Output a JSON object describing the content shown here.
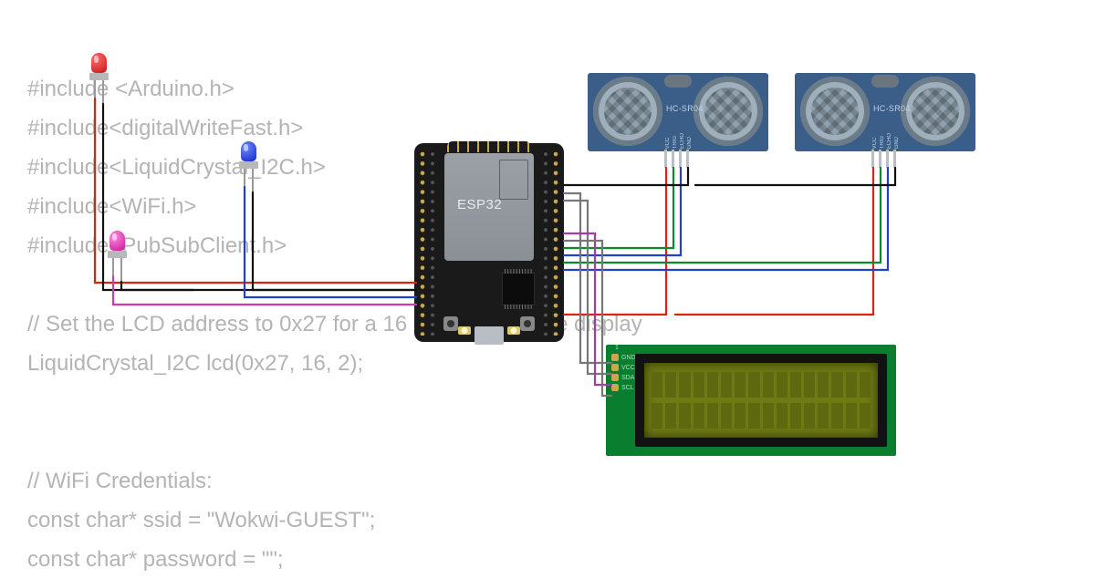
{
  "code_lines": [
    "#include <Arduino.h>",
    "#include<digitalWriteFast.h>",
    "#include<LiquidCrystal_I2C.h>",
    "#include<WiFi.h>",
    "#include<PubSubClient.h>",
    "",
    "// Set the LCD address to 0x27 for a 16 chars and 2 line display",
    "LiquidCrystal_I2C lcd(0x27, 16, 2);",
    "",
    "",
    "// WiFi Credentials:",
    "const char* ssid = \"Wokwi-GUEST\";",
    "const char* password = \"\";"
  ],
  "esp32": {
    "label": "ESP32"
  },
  "sonar": {
    "brand": "HC-SR04",
    "pins": [
      "VCC",
      "TRIG",
      "ECHO",
      "GND"
    ]
  },
  "lcd": {
    "title": "1",
    "pins": [
      "GND",
      "VCC",
      "SDA",
      "SCL"
    ],
    "cols": 16,
    "rows": 2
  },
  "leds": {
    "red": "red-led",
    "blue": "blue-led",
    "pink": "pink-led"
  }
}
